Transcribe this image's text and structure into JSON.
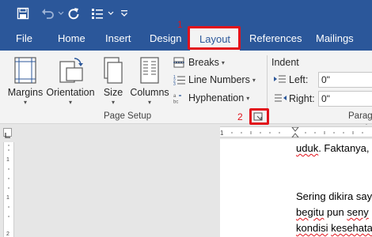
{
  "quick_access": {
    "icons": [
      "save-icon",
      "undo-icon",
      "redo-icon",
      "touch-mode-icon",
      "customize-qat-icon"
    ]
  },
  "tabs": [
    "File",
    "Home",
    "Insert",
    "Design",
    "Layout",
    "References",
    "Mailings"
  ],
  "active_tab": "Layout",
  "markers": {
    "one": "1",
    "two": "2"
  },
  "ribbon": {
    "page_setup": {
      "buttons": {
        "margins": "Margins",
        "orientation": "Orientation",
        "size": "Size",
        "columns": "Columns"
      },
      "small": {
        "breaks": "Breaks",
        "line_numbers": "Line Numbers",
        "hyphenation": "Hyphenation"
      },
      "label": "Page Setup"
    },
    "paragraph": {
      "indent_title": "Indent",
      "left_label": "Left:",
      "left_value": "0\"",
      "right_label": "Right:",
      "right_value": "0\"",
      "label": "Parag"
    }
  },
  "document": {
    "line1_word1": "uduk",
    "line1_rest": ". Faktanya,",
    "line2_word": "Sering",
    "line2_rest": " dikira say",
    "line3_word1": "begitu",
    "line3_mid": " pun ",
    "line3_word2": "seny",
    "line4_word1": "kondisi",
    "line4_word2": "kesehata"
  },
  "colors": {
    "ribbon_blue": "#2b579a",
    "highlight_red": "#e2121b"
  }
}
